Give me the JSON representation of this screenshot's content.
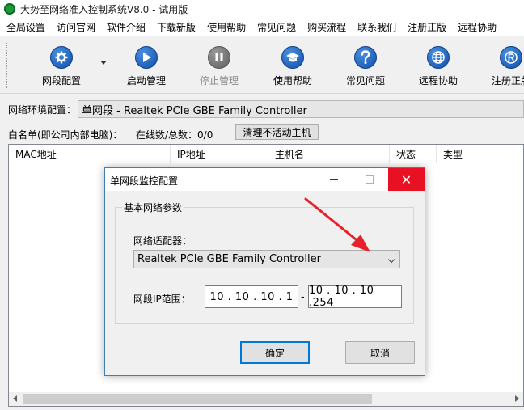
{
  "window": {
    "title": "大势至网络准入控制系统V8.0 - 试用版"
  },
  "menu": [
    "全局设置",
    "访问官网",
    "软件介绍",
    "下载新版",
    "使用帮助",
    "常见问题",
    "购买流程",
    "联系我们",
    "注册正版",
    "远程协助"
  ],
  "toolbar": {
    "buttons": [
      {
        "label": "网段配置",
        "icon": "gear-icon",
        "enabled": true
      },
      {
        "label": "启动管理",
        "icon": "play-icon",
        "enabled": true
      },
      {
        "label": "停止管理",
        "icon": "pause-icon",
        "enabled": false
      },
      {
        "label": "使用帮助",
        "icon": "graduation-cap-icon",
        "enabled": true
      },
      {
        "label": "常见问题",
        "icon": "question-icon",
        "enabled": true
      },
      {
        "label": "远程协助",
        "icon": "globe-icon",
        "enabled": true
      },
      {
        "label": "注册正版",
        "icon": "registered-icon",
        "enabled": true
      }
    ]
  },
  "env": {
    "label": "网络环境配置：",
    "value": "单网段 - Realtek PCIe GBE Family Controller"
  },
  "whitelist": {
    "label": "白名单(即公司内部电脑)：",
    "count": "在线数/总数：0/0",
    "clear_button": "清理不活动主机"
  },
  "table": {
    "columns": [
      "MAC地址",
      "IP地址",
      "主机名",
      "状态",
      "类型"
    ]
  },
  "dialog": {
    "title": "单网段监控配置",
    "close_glyph": "✕",
    "group_title": "基本网络参数",
    "adapter_label": "网络适配器：",
    "adapter_value": "Realtek PCIe GBE Family Controller",
    "ip_label": "网段IP范围：",
    "ip_start": "10 . 10 . 10 . 1",
    "ip_dash": "-",
    "ip_end": "10 . 10 . 10 .254",
    "ok_button": "确定",
    "cancel_button": "取消"
  },
  "colors": {
    "accent_blue": "#0f4fa8",
    "close_red": "#e81123",
    "annotation_red": "#e8202a",
    "dialog_border": "#3c7fb1"
  }
}
